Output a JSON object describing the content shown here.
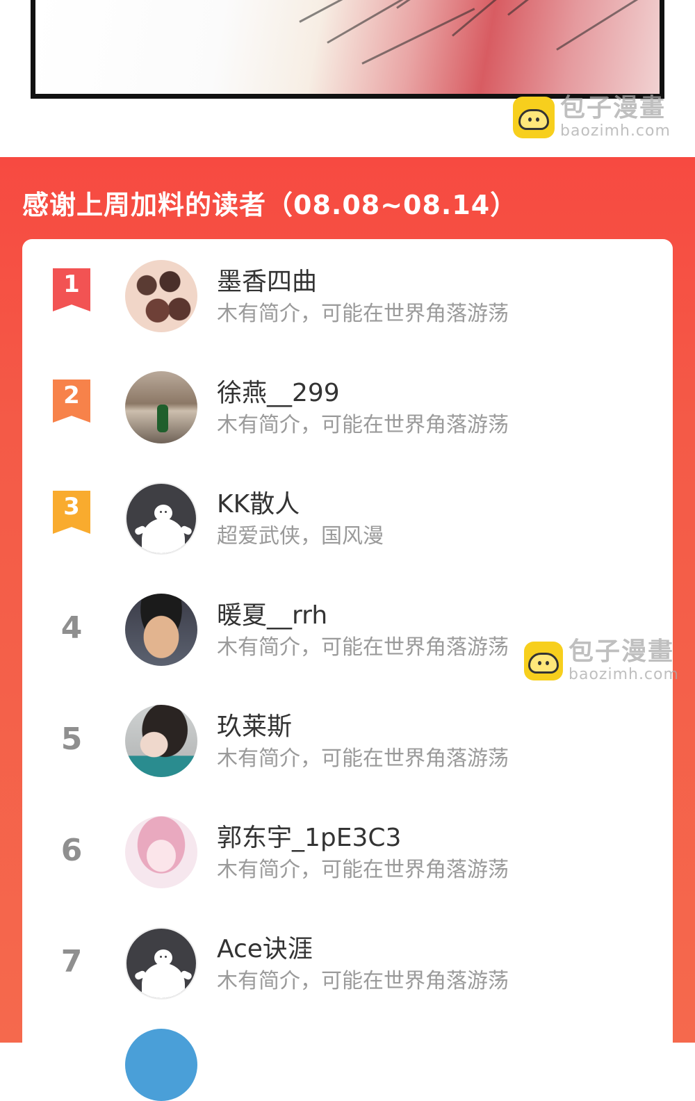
{
  "watermark": {
    "brand_cn": "包子漫畫",
    "brand_url": "baozimh.com"
  },
  "board": {
    "title": "感谢上周加料的读者（08.08~08.14）",
    "readers": [
      {
        "rank": "1",
        "name": "墨香四曲",
        "bio": "木有简介，可能在世界角落游荡"
      },
      {
        "rank": "2",
        "name": "徐燕__299",
        "bio": "木有简介，可能在世界角落游荡"
      },
      {
        "rank": "3",
        "name": "KK散人",
        "bio": "超爱武侠，国风漫"
      },
      {
        "rank": "4",
        "name": "暖夏__rrh",
        "bio": "木有简介，可能在世界角落游荡"
      },
      {
        "rank": "5",
        "name": "玖莱斯",
        "bio": "木有简介，可能在世界角落游荡"
      },
      {
        "rank": "6",
        "name": "郭东宇_1pE3C3",
        "bio": "木有简介，可能在世界角落游荡"
      },
      {
        "rank": "7",
        "name": "Ace诀涯",
        "bio": "木有简介，可能在世界角落游荡"
      }
    ]
  },
  "colors": {
    "board_red": "#f74a41",
    "rank1": "#f25353",
    "rank2": "#f7824a",
    "rank3": "#f9ab2e",
    "watermark_yellow": "#f7cf1d"
  }
}
